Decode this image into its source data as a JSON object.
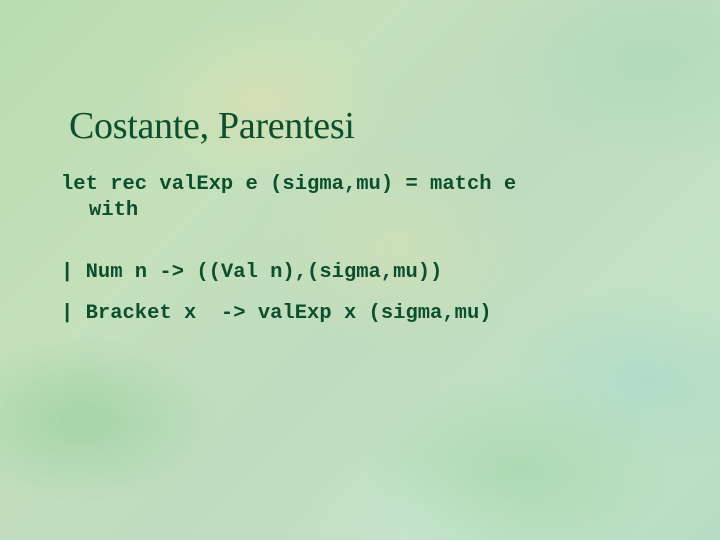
{
  "slide": {
    "title": "Costante, Parentesi",
    "code_lines": [
      "let rec valExp e (sigma,mu) = match e",
      "with",
      "| Num n -> ((Val n),(sigma,mu))",
      "| Bracket x  -> valExp x (sigma,mu)"
    ],
    "colors": {
      "text": "#0d4f2c",
      "background": "#c0dfbb"
    }
  }
}
